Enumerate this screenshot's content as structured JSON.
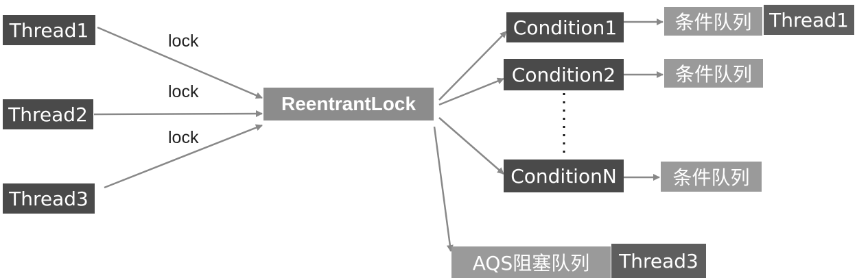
{
  "threads": {
    "t1": "Thread1",
    "t2": "Thread2",
    "t3": "Thread3"
  },
  "edge_labels": {
    "l1": "lock",
    "l2": "lock",
    "l3": "lock"
  },
  "lock": "ReentrantLock",
  "conditions": {
    "c1": "Condition1",
    "c2": "Condition2",
    "cn": "ConditionN"
  },
  "queues": {
    "q1": "条件队列",
    "q2": "条件队列",
    "qn": "条件队列"
  },
  "queue_thread": "Thread1",
  "aqs": {
    "label": "AQS阻塞队列",
    "thread": "Thread3"
  },
  "colors": {
    "dark_box": "#4a4a4a",
    "light_box": "#8c8c8c",
    "arrow": "#888888"
  }
}
